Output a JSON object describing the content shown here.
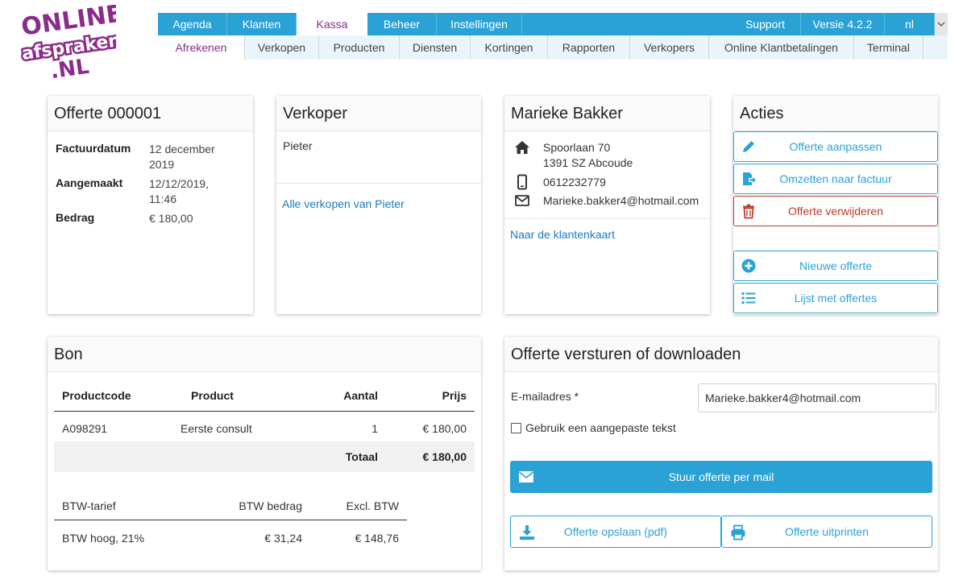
{
  "logo": {
    "line1": "ONLINE",
    "line2": "afspraken",
    "line3": ".NL"
  },
  "topnav": {
    "tabs": [
      "Agenda",
      "Klanten",
      "Kassa",
      "Beheer",
      "Instellingen"
    ],
    "support": "Support",
    "version": "Versie 4.2.2",
    "language": "nl",
    "language_dropdown_icon": "chevron-down-icon"
  },
  "subnav": {
    "items": [
      "Afrekenen",
      "Verkopen",
      "Producten",
      "Diensten",
      "Kortingen",
      "Rapporten",
      "Verkopers",
      "Online Klantbetalingen",
      "Terminal"
    ]
  },
  "offerte": {
    "title": "Offerte 000001",
    "factuurdatum_label": "Factuurdatum",
    "factuurdatum_value": "12 december 2019",
    "aangemaakt_label": "Aangemaakt",
    "aangemaakt_value": "12/12/2019, 11:46",
    "bedrag_label": "Bedrag",
    "bedrag_value": "€ 180,00"
  },
  "verkoper": {
    "title": "Verkoper",
    "name": "Pieter",
    "link": "Alle verkopen van Pieter"
  },
  "customer": {
    "name": "Marieke Bakker",
    "address_line1": "Spoorlaan 70",
    "address_line2": "1391 SZ Abcoude",
    "phone": "0612232779",
    "email": "Marieke.bakker4@hotmail.com",
    "link": "Naar de klantenkaart"
  },
  "acties": {
    "title": "Acties",
    "edit": "Offerte aanpassen",
    "convert": "Omzetten naar factuur",
    "delete": "Offerte verwijderen",
    "new": "Nieuwe offerte",
    "list": "Lijst met offertes"
  },
  "bon": {
    "title": "Bon",
    "headers": {
      "code": "Productcode",
      "product": "Product",
      "qty": "Aantal",
      "price": "Prijs"
    },
    "rows": [
      {
        "code": "A098291",
        "product": "Eerste consult",
        "qty": "1",
        "price": "€ 180,00"
      }
    ],
    "total_label": "Totaal",
    "total_value": "€ 180,00",
    "vat_headers": {
      "rate": "BTW-tarief",
      "amount": "BTW bedrag",
      "excl": "Excl. BTW"
    },
    "vat_rows": [
      {
        "rate": "BTW hoog, 21%",
        "amount": "€ 31,24",
        "excl": "€ 148,76"
      }
    ]
  },
  "send": {
    "title": "Offerte versturen of downloaden",
    "email_label": "E-mailadres *",
    "email_value": "Marieke.bakker4@hotmail.com",
    "custom_text_label": "Gebruik een aangepaste tekst",
    "custom_text_checked": false,
    "mail_button": "Stuur offerte per mail",
    "pdf_button": "Offerte opslaan (pdf)",
    "print_button": "Offerte uitprinten"
  },
  "colors": {
    "accent": "#2aa2d6",
    "active_tab_text": "#8b2c8a",
    "danger": "#c0392b",
    "link": "#1c79c0",
    "logo_purple": "#8b2c8a"
  }
}
